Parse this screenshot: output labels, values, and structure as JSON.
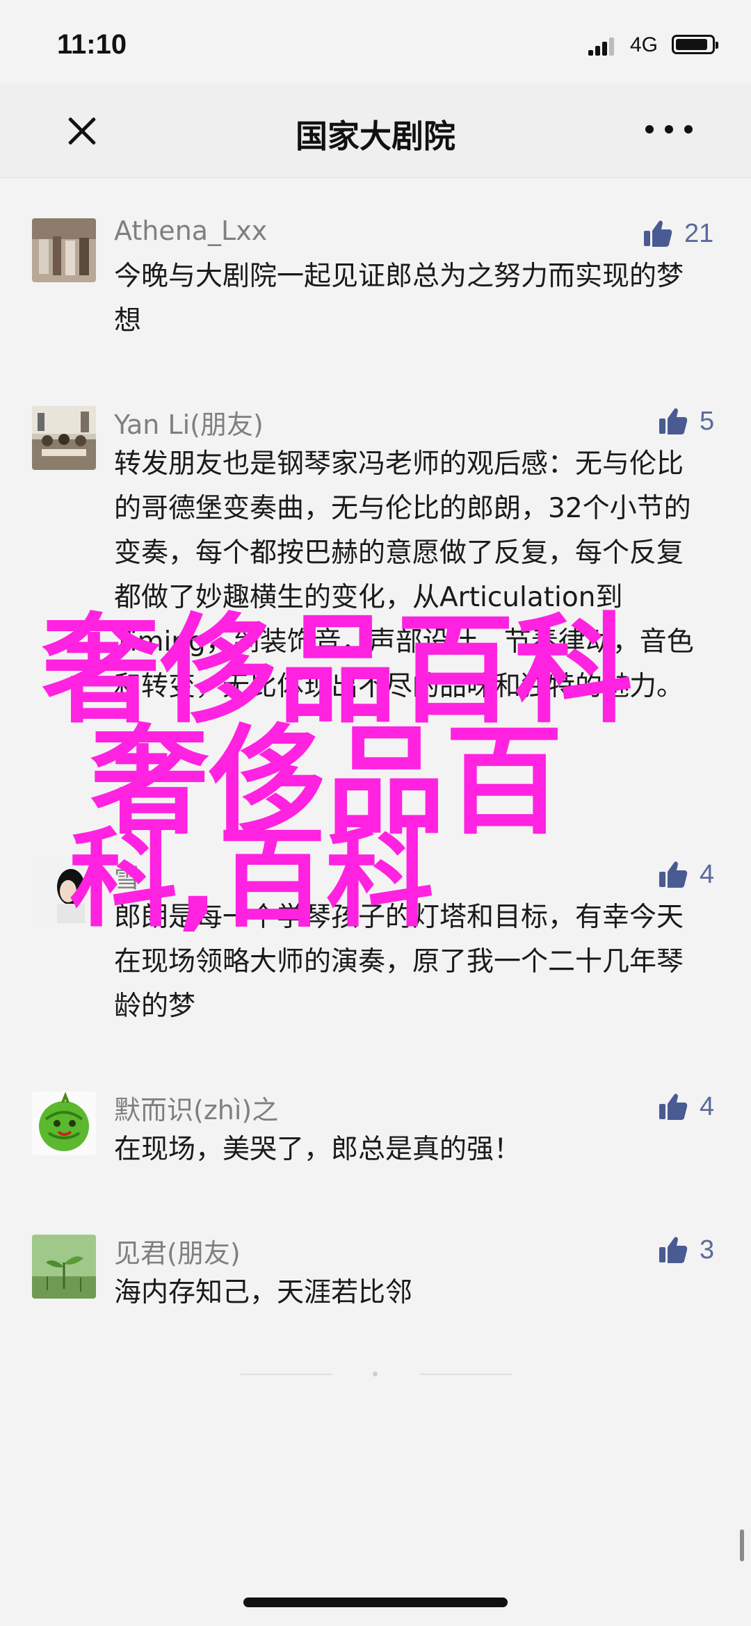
{
  "status": {
    "time": "11:10",
    "network": "4G",
    "battery_level": 0.9
  },
  "nav": {
    "title": "国家大剧院",
    "close_icon": "close-icon",
    "more_icon": "more-icon"
  },
  "comments": [
    {
      "name": "Athena_Lxx",
      "text": "今晚与大剧院一起见证郎总为之努力而实现的梦想",
      "likes": "21"
    },
    {
      "name": "Yan Li(朋友)",
      "text": "转发朋友也是钢琴家冯老师的观后感：无与伦比的哥德堡变奏曲，无与伦比的郎朗，32个小节的变奏，每个都按巴赫的意愿做了反复，每个反复都做了妙趣横生的变化，从Articulation到Timing，到装饰音，声部设计，节奏律动，音色和转变，无比体现出不尽的品味和独特的魅力。",
      "likes": "5"
    },
    {
      "name": "雪",
      "text": "郎朗是每一个学琴孩子的灯塔和目标，有幸今天在现场领略大师的演奏，原了我一个二十几年琴龄的梦",
      "likes": "4"
    },
    {
      "name": "默而识(zhì)之",
      "text": "在现场，美哭了，郎总是真的强！",
      "likes": "4"
    },
    {
      "name": "见君(朋友)",
      "text": "海内存知己，天涯若比邻",
      "likes": "3"
    }
  ],
  "watermark": {
    "line1": "奢侈品百科",
    "line2": "奢侈品百",
    "line3": "科,百科"
  }
}
